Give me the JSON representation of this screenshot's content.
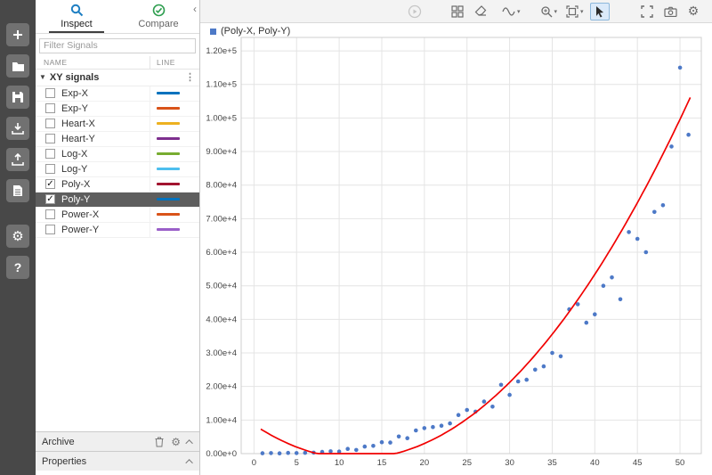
{
  "left_toolbar": {
    "buttons": [
      {
        "name": "add",
        "icon": "plus-icon"
      },
      {
        "name": "open",
        "icon": "folder-icon"
      },
      {
        "name": "save",
        "icon": "save-icon"
      },
      {
        "name": "import",
        "icon": "import-icon"
      },
      {
        "name": "export",
        "icon": "export-icon"
      },
      {
        "name": "report",
        "icon": "report-icon"
      },
      {
        "name": "preferences",
        "icon": "gear-icon"
      },
      {
        "name": "help",
        "icon": "help-icon"
      }
    ]
  },
  "sidebar": {
    "collapse_label": "‹",
    "tabs": [
      {
        "label": "Inspect",
        "icon": "search-icon",
        "active": true
      },
      {
        "label": "Compare",
        "icon": "check-circle-icon",
        "active": false
      }
    ],
    "filter_placeholder": "Filter Signals",
    "table": {
      "columns": [
        "NAME",
        "LINE"
      ],
      "group_label": "XY signals",
      "group_expanded": true,
      "signals": [
        {
          "name": "Exp-X",
          "color": "#0072BD",
          "checked": false,
          "selected": false
        },
        {
          "name": "Exp-Y",
          "color": "#D95319",
          "checked": false,
          "selected": false
        },
        {
          "name": "Heart-X",
          "color": "#EDB120",
          "checked": false,
          "selected": false
        },
        {
          "name": "Heart-Y",
          "color": "#7E2F8E",
          "checked": false,
          "selected": false
        },
        {
          "name": "Log-X",
          "color": "#77AC30",
          "checked": false,
          "selected": false
        },
        {
          "name": "Log-Y",
          "color": "#4DBEEE",
          "checked": false,
          "selected": false
        },
        {
          "name": "Poly-X",
          "color": "#A2142F",
          "checked": true,
          "selected": false
        },
        {
          "name": "Poly-Y",
          "color": "#0072BD",
          "checked": true,
          "selected": true
        },
        {
          "name": "Power-X",
          "color": "#D95319",
          "checked": false,
          "selected": false
        },
        {
          "name": "Power-Y",
          "color": "#9A5FC9",
          "checked": false,
          "selected": false
        }
      ]
    },
    "archive_label": "Archive",
    "properties_label": "Properties"
  },
  "chart_toolbar": {
    "buttons": [
      "run",
      "layout",
      "eraser",
      "signal-style",
      "zoom",
      "fit-view",
      "pointer",
      "fullscreen",
      "snapshot",
      "settings"
    ],
    "active_button": "pointer",
    "disabled_buttons": [
      "run"
    ]
  },
  "chart_data": {
    "type": "scatter",
    "legend": "(Poly-X, Poly-Y)",
    "legend_position": "top-left",
    "grid": true,
    "xlim": [
      -1.5,
      52.5
    ],
    "ylim": [
      0,
      124000
    ],
    "x_ticks": [
      0,
      5,
      10,
      15,
      20,
      25,
      30,
      35,
      40,
      45,
      50
    ],
    "y_ticks": [
      {
        "v": 0,
        "label": "0.00e+0"
      },
      {
        "v": 10000,
        "label": "1.00e+4"
      },
      {
        "v": 20000,
        "label": "2.00e+4"
      },
      {
        "v": 30000,
        "label": "3.00e+4"
      },
      {
        "v": 40000,
        "label": "4.00e+4"
      },
      {
        "v": 50000,
        "label": "5.00e+4"
      },
      {
        "v": 60000,
        "label": "6.00e+4"
      },
      {
        "v": 70000,
        "label": "7.00e+4"
      },
      {
        "v": 80000,
        "label": "8.00e+4"
      },
      {
        "v": 90000,
        "label": "9.00e+4"
      },
      {
        "v": 100000,
        "label": "1.00e+5"
      },
      {
        "v": 110000,
        "label": "1.10e+5"
      },
      {
        "v": 120000,
        "label": "1.20e+5"
      }
    ],
    "series": [
      {
        "name": "Poly-Y vs Poly-X",
        "type": "scatter",
        "color": "#4d79c7",
        "x": [
          1,
          2,
          3,
          4,
          5,
          6,
          7,
          8,
          9,
          10,
          11,
          12,
          13,
          14,
          15,
          16,
          17,
          18,
          19,
          20,
          21,
          22,
          23,
          24,
          25,
          26,
          27,
          28,
          29,
          30,
          31,
          32,
          33,
          34,
          35,
          36,
          37,
          38,
          39,
          40,
          41,
          42,
          43,
          44,
          45,
          46,
          47,
          48,
          49,
          50,
          51
        ],
        "y": [
          100,
          150,
          80,
          200,
          150,
          250,
          300,
          500,
          700,
          600,
          1400,
          1100,
          2100,
          2300,
          3400,
          3300,
          5100,
          4600,
          6900,
          7600,
          7900,
          8300,
          9000,
          11500,
          13000,
          12500,
          15500,
          14000,
          20500,
          17500,
          21500,
          22000,
          25000,
          26000,
          30000,
          29000,
          43000,
          44500,
          39000,
          41500,
          50000,
          52500,
          46000,
          66000,
          64000,
          60000,
          72000,
          74000,
          91500,
          115000,
          95000
        ]
      },
      {
        "name": "quadratic-fit",
        "type": "line",
        "color": "#F10000",
        "fit": {
          "kind": "quadratic",
          "a": 70,
          "b": -1680,
          "c": 8610,
          "x_range": [
            0.8,
            51.3
          ]
        }
      }
    ]
  }
}
